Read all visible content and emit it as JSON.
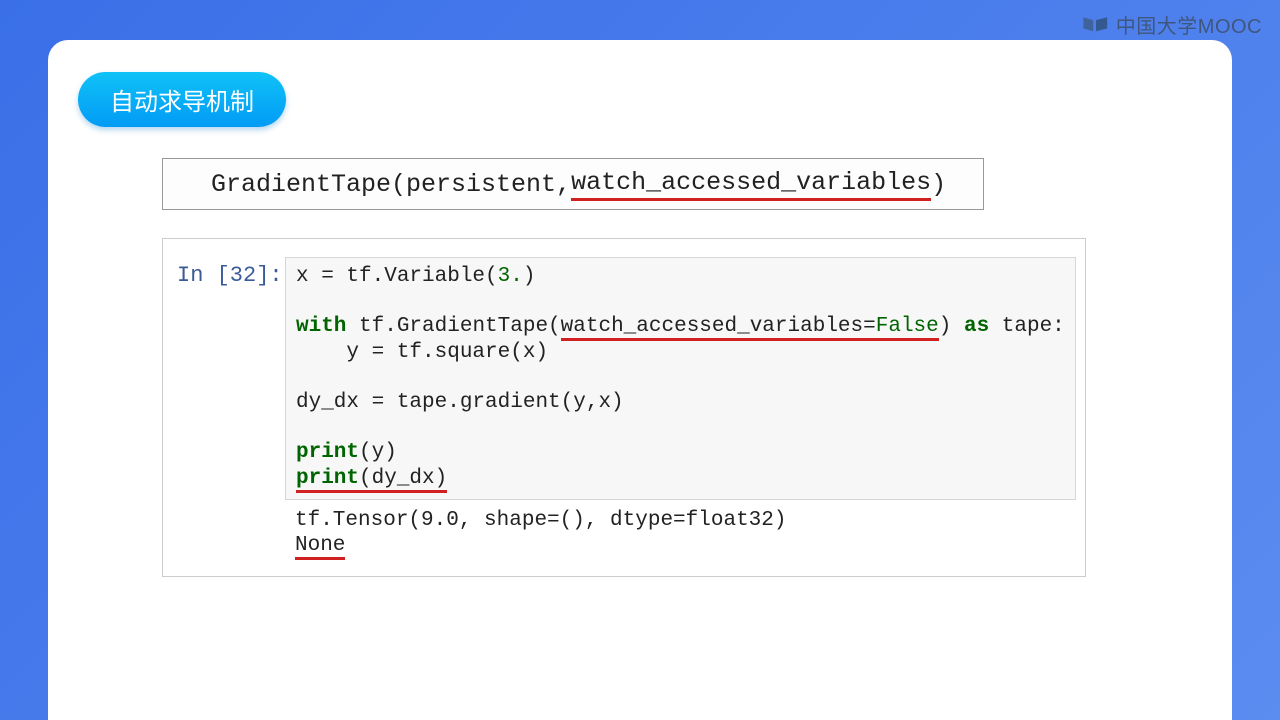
{
  "watermark": {
    "text": "中国大学MOOC"
  },
  "pill_title": "自动求导机制",
  "api_signature": {
    "prefix": "GradientTape(persistent,",
    "underlined": "watch_accessed_variables",
    "suffix": ")"
  },
  "cell": {
    "prompt": "In [32]:",
    "code": {
      "line1_a": "x = tf.Variable(",
      "line1_num": "3.",
      "line1_b": ")",
      "line2_kw_with": "with",
      "line2_a": " tf.GradientTape(",
      "line2_under": "watch_accessed_variables=",
      "line2_bool": "False",
      "line2_b": ")",
      "line2_kw_as": " as",
      "line2_c": " tape:",
      "line3": "    y = tf.square(x)",
      "line4": "dy_dx = tape.gradient(y,x)",
      "line5_kw": "print",
      "line5_a": "(y)",
      "line6_kw": "print",
      "line6_a": "(dy_dx)"
    },
    "output": {
      "line1": "tf.Tensor(9.0, shape=(), dtype=float32)",
      "line2": "None"
    }
  }
}
